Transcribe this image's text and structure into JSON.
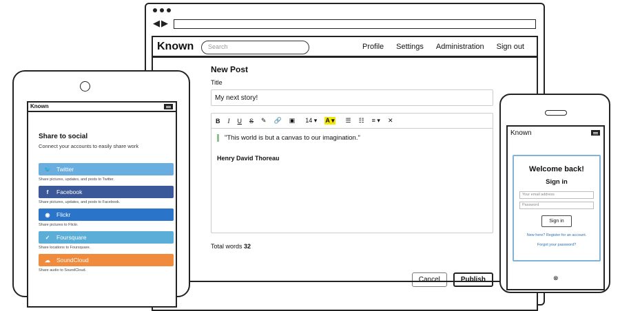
{
  "desktop": {
    "brand": "Known",
    "search_placeholder": "Search",
    "nav": [
      "Profile",
      "Settings",
      "Administration",
      "Sign out"
    ],
    "editor": {
      "heading": "New Post",
      "title_label": "Title",
      "title_value": "My next story!",
      "toolbar": [
        "B",
        "I",
        "U",
        "S",
        "✎",
        "🔗",
        "▣",
        "14 ▾",
        "A ▾",
        "☰",
        "☷",
        "≡ ▾",
        "✕"
      ],
      "quote": "\"This world is but a canvas to our imagination.\"",
      "author": "Henry David Thoreau",
      "total_label": "Total words",
      "total_value": "32",
      "cancel": "Cancel",
      "publish": "Publish"
    }
  },
  "tablet": {
    "brand": "Known",
    "heading": "Share to social",
    "subtitle": "Connect your accounts to easily share work",
    "services": [
      {
        "name": "Twitter",
        "icon": "bird-icon",
        "glyph": "🐦",
        "color": "#6aaee0",
        "desc": "Share pictures, updates, and posts to Twitter."
      },
      {
        "name": "Facebook",
        "icon": "facebook-icon",
        "glyph": "f",
        "color": "#3b5998",
        "desc": "Share pictures, updates, and posts to Facebook."
      },
      {
        "name": "Flickr",
        "icon": "flickr-icon",
        "glyph": "◉",
        "color": "#2a74c9",
        "desc": "Share pictures to Flickr."
      },
      {
        "name": "Foursquare",
        "icon": "foursquare-icon",
        "glyph": "✓",
        "color": "#5aaed8",
        "desc": "Share locations to Foursquare."
      },
      {
        "name": "SoundCloud",
        "icon": "cloud-icon",
        "glyph": "☁",
        "color": "#f08a3c",
        "desc": "Share audio to SoundCloud."
      }
    ]
  },
  "phone": {
    "brand": "Known",
    "welcome": "Welcome back!",
    "signin_heading": "Sign in",
    "email_placeholder": "Your email address",
    "password_placeholder": "Password",
    "signin_button": "Sign in",
    "register_link": "New here? Register for an account.",
    "forgot_link": "Forgot your password?",
    "footer_symbol": "⊗"
  }
}
